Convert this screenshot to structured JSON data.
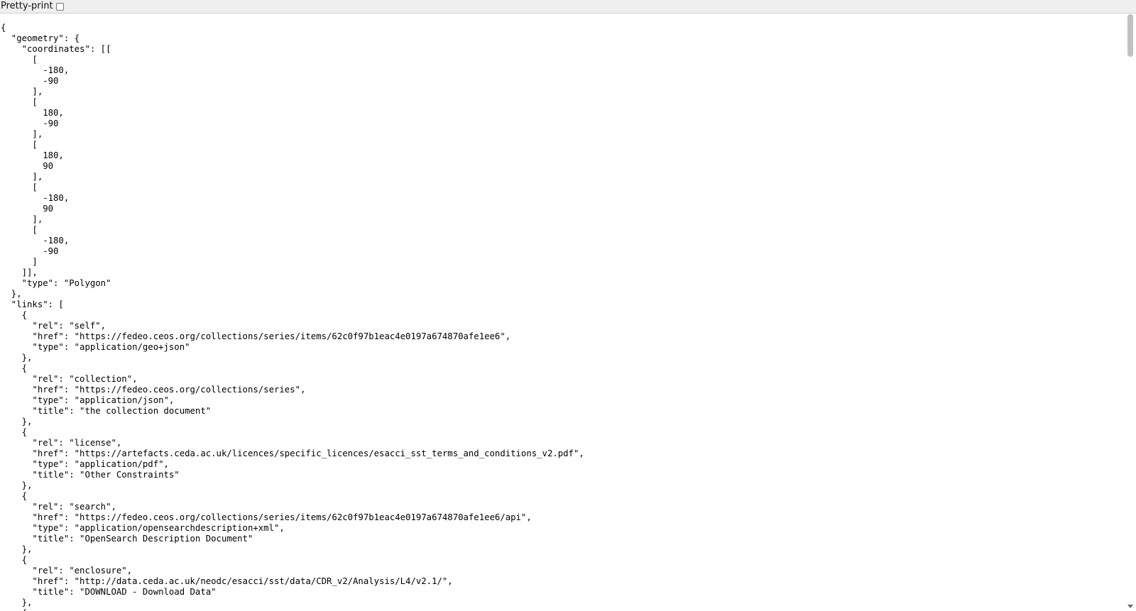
{
  "toolbar": {
    "pretty_print_label": "Pretty-print",
    "pretty_print_checked": false
  },
  "json_text": "{\n  \"geometry\": {\n    \"coordinates\": [[\n      [\n        -180,\n        -90\n      ],\n      [\n        180,\n        -90\n      ],\n      [\n        180,\n        90\n      ],\n      [\n        -180,\n        90\n      ],\n      [\n        -180,\n        -90\n      ]\n    ]],\n    \"type\": \"Polygon\"\n  },\n  \"links\": [\n    {\n      \"rel\": \"self\",\n      \"href\": \"https://fedeo.ceos.org/collections/series/items/62c0f97b1eac4e0197a674870afe1ee6\",\n      \"type\": \"application/geo+json\"\n    },\n    {\n      \"rel\": \"collection\",\n      \"href\": \"https://fedeo.ceos.org/collections/series\",\n      \"type\": \"application/json\",\n      \"title\": \"the collection document\"\n    },\n    {\n      \"rel\": \"license\",\n      \"href\": \"https://artefacts.ceda.ac.uk/licences/specific_licences/esacci_sst_terms_and_conditions_v2.pdf\",\n      \"type\": \"application/pdf\",\n      \"title\": \"Other Constraints\"\n    },\n    {\n      \"rel\": \"search\",\n      \"href\": \"https://fedeo.ceos.org/collections/series/items/62c0f97b1eac4e0197a674870afe1ee6/api\",\n      \"type\": \"application/opensearchdescription+xml\",\n      \"title\": \"OpenSearch Description Document\"\n    },\n    {\n      \"rel\": \"enclosure\",\n      \"href\": \"http://data.ceda.ac.uk/neodc/esacci/sst/data/CDR_v2/Analysis/L4/v2.1/\",\n      \"title\": \"DOWNLOAD - Download Data\"\n    },\n    {"
}
